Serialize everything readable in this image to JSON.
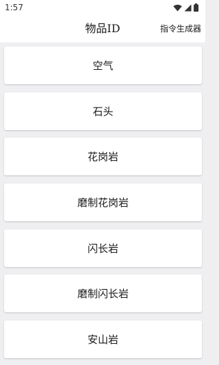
{
  "status_bar": {
    "time": "1:57",
    "icons": [
      "wifi-icon",
      "cellular-signal-icon",
      "battery-icon"
    ]
  },
  "app_bar": {
    "title": "物品ID",
    "action_label": "指令生成器"
  },
  "items": [
    {
      "label": "空气"
    },
    {
      "label": "石头"
    },
    {
      "label": "花岗岩"
    },
    {
      "label": "磨制花岗岩"
    },
    {
      "label": "闪长岩"
    },
    {
      "label": "磨制闪长岩"
    },
    {
      "label": "安山岩"
    }
  ],
  "colors": {
    "background": "#efeff2",
    "surface": "#ffffff",
    "text": "#1a1a1a"
  }
}
